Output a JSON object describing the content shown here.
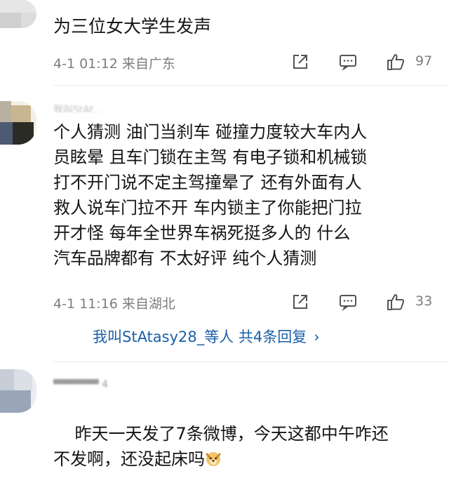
{
  "comments": [
    {
      "text": "为三位女大学生发声",
      "time_location": "4-1 01:12 来自广东",
      "likes": "97"
    },
    {
      "text": "个人猜测 油门当刹车 碰撞力度较大车内人\n员眩晕 且车门锁在主驾 有电子锁和机械锁\n打不开门说不定主驾撞晕了 还有外面有人\n救人说车门拉不开 车内锁主了你能把门拉\n开才怪 每年全世界车祸死挺多人的 什么\n汽车品牌都有 不太好评 纯个人猜测",
      "username_blurred": "我叫StAt...",
      "time_location": "4-1 11:16 来自湖北",
      "likes": "33",
      "replies_label": "我叫StAtasy28_等人 共4条回复",
      "replies_chevron": "›"
    },
    {
      "text": "昨天一天发了7条微博，今天这都中午咋还\n不发啊，还没起床吗",
      "username_blurred": "▀▀▀▀▀▀       4",
      "emoji": "dog-face-emoji"
    }
  ],
  "icons": {
    "share": "share-icon",
    "comment": "comment-icon",
    "like": "thumbs-up-icon"
  },
  "colors": {
    "link": "#1b5fa8",
    "meta": "#7d7d7d",
    "text": "#141414"
  }
}
